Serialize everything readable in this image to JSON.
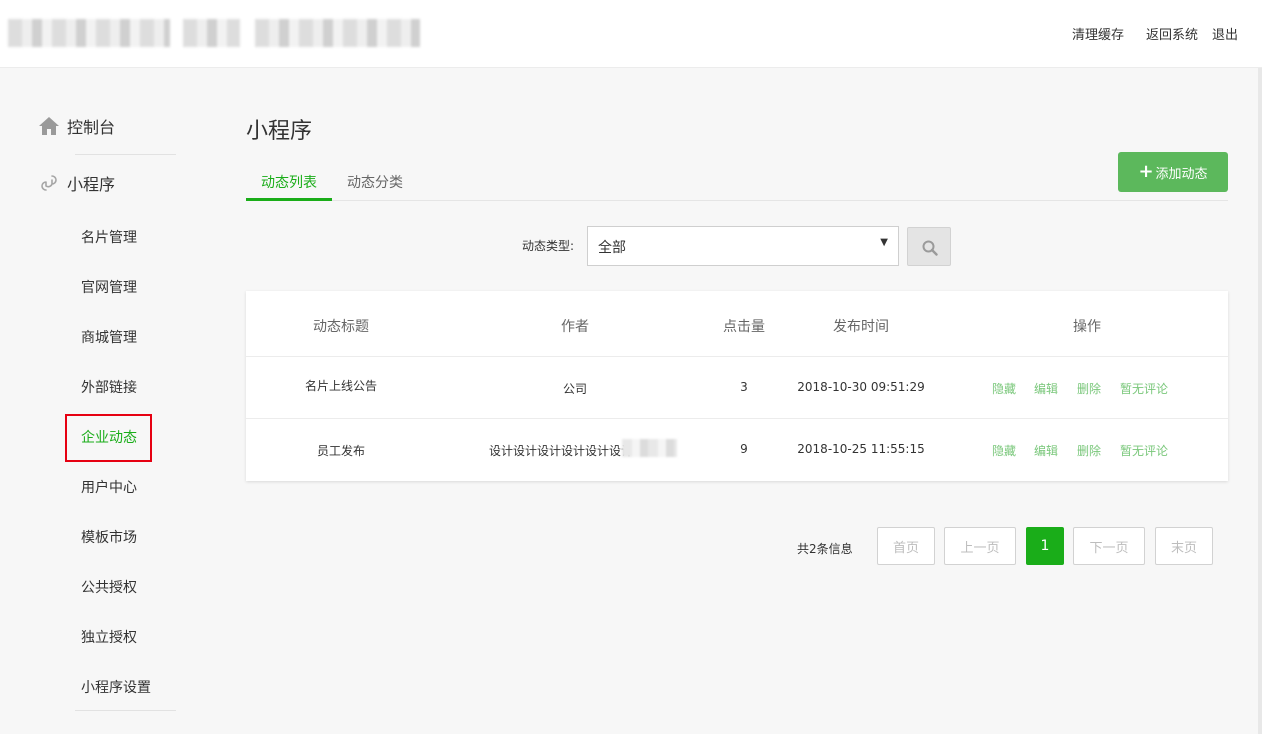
{
  "header": {
    "clear_cache": "清理缓存",
    "return_system": "返回系统",
    "logout": "退出"
  },
  "sidebar": {
    "console": "控制台",
    "miniprogram": "小程序",
    "items": [
      {
        "label": "名片管理"
      },
      {
        "label": "官网管理"
      },
      {
        "label": "商城管理"
      },
      {
        "label": "外部链接"
      },
      {
        "label": "企业动态"
      },
      {
        "label": "用户中心"
      },
      {
        "label": "模板市场"
      },
      {
        "label": "公共授权"
      },
      {
        "label": "独立授权"
      },
      {
        "label": "小程序设置"
      }
    ],
    "active_index": 4
  },
  "main": {
    "title": "小程序",
    "tabs": [
      {
        "label": "动态列表"
      },
      {
        "label": "动态分类"
      }
    ],
    "add_button": "添加动态",
    "filter": {
      "label": "动态类型:",
      "value": "全部"
    },
    "table": {
      "headers": [
        "动态标题",
        "作者",
        "点击量",
        "发布时间",
        "操作"
      ],
      "rows": [
        {
          "title": "名片上线公告",
          "author": "公司",
          "clicks": "3",
          "time": "2018-10-30 09:51:29"
        },
        {
          "title": "员工发布",
          "author": "设计设计设计设计设计设计",
          "clicks": "9",
          "time": "2018-10-25 11:55:15"
        }
      ],
      "actions": [
        "隐藏",
        "编辑",
        "删除",
        "暂无评论"
      ]
    },
    "pagination": {
      "info": "共2条信息",
      "first": "首页",
      "prev": "上一页",
      "current": "1",
      "next": "下一页",
      "last": "末页"
    }
  },
  "colors": {
    "accent": "#1aad19",
    "add_button": "#5cb85c",
    "action_link": "#79c77a",
    "highlight_box": "#e60012"
  }
}
